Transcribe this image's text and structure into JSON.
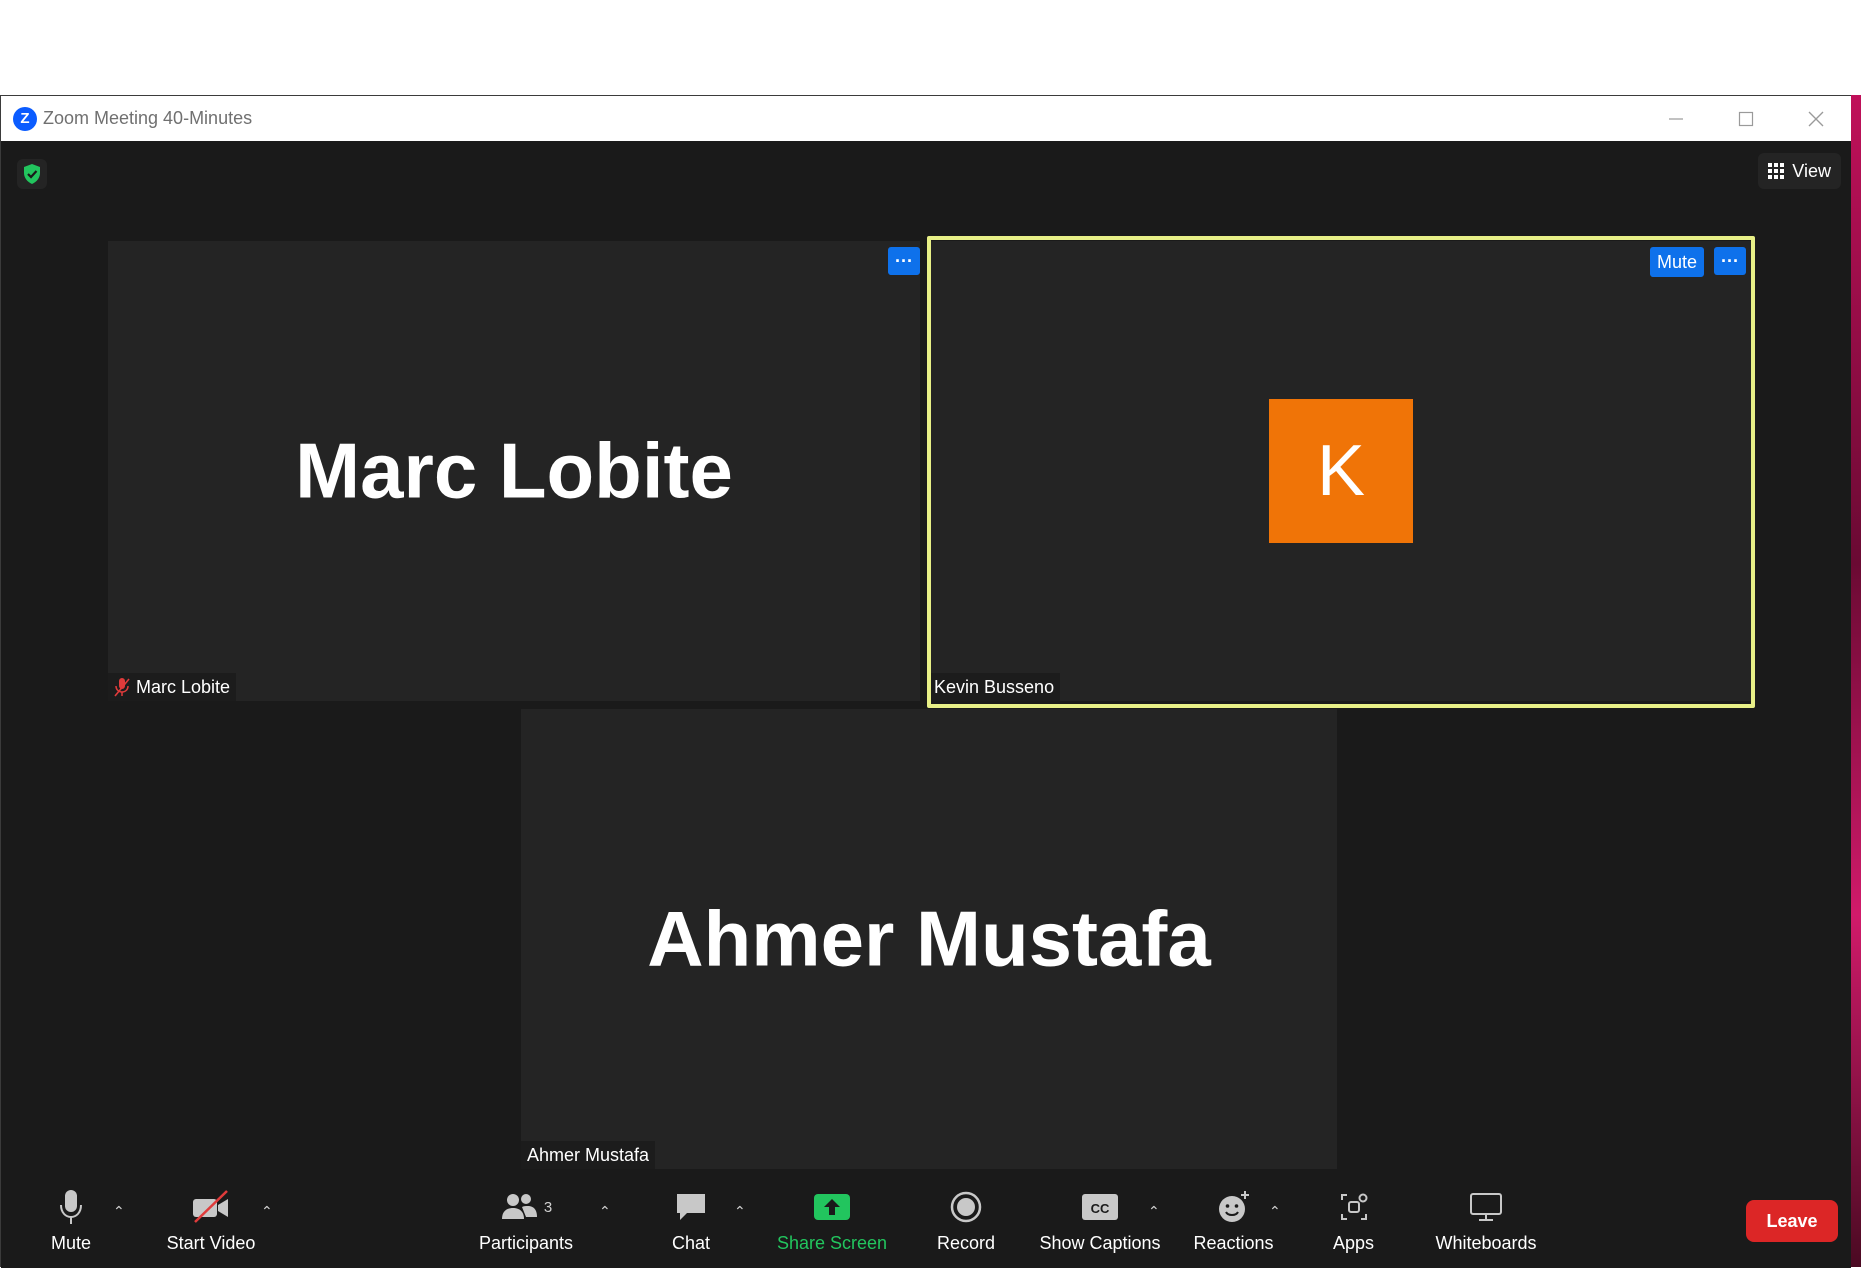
{
  "window": {
    "title": "Zoom Meeting 40-Minutes"
  },
  "top": {
    "view_label": "View"
  },
  "tiles": {
    "marc": {
      "display_name": "Marc Lobite",
      "name_tag": "Marc Lobite"
    },
    "kevin": {
      "initial": "K",
      "name_tag": "Kevin Busseno",
      "mute_label": "Mute"
    },
    "ahmer": {
      "display_name": "Ahmer Mustafa",
      "name_tag": "Ahmer Mustafa"
    }
  },
  "toolbar": {
    "mute": "Mute",
    "start_video": "Start Video",
    "participants": "Participants",
    "participants_count": "3",
    "chat": "Chat",
    "share_screen": "Share Screen",
    "record": "Record",
    "show_captions": "Show Captions",
    "reactions": "Reactions",
    "apps": "Apps",
    "whiteboards": "Whiteboards",
    "leave": "Leave"
  },
  "colors": {
    "accent_blue": "#0e71eb",
    "active_speaker": "#e8f087",
    "leave_red": "#dc2626",
    "share_green": "#22c55e",
    "avatar_orange": "#f07407"
  }
}
